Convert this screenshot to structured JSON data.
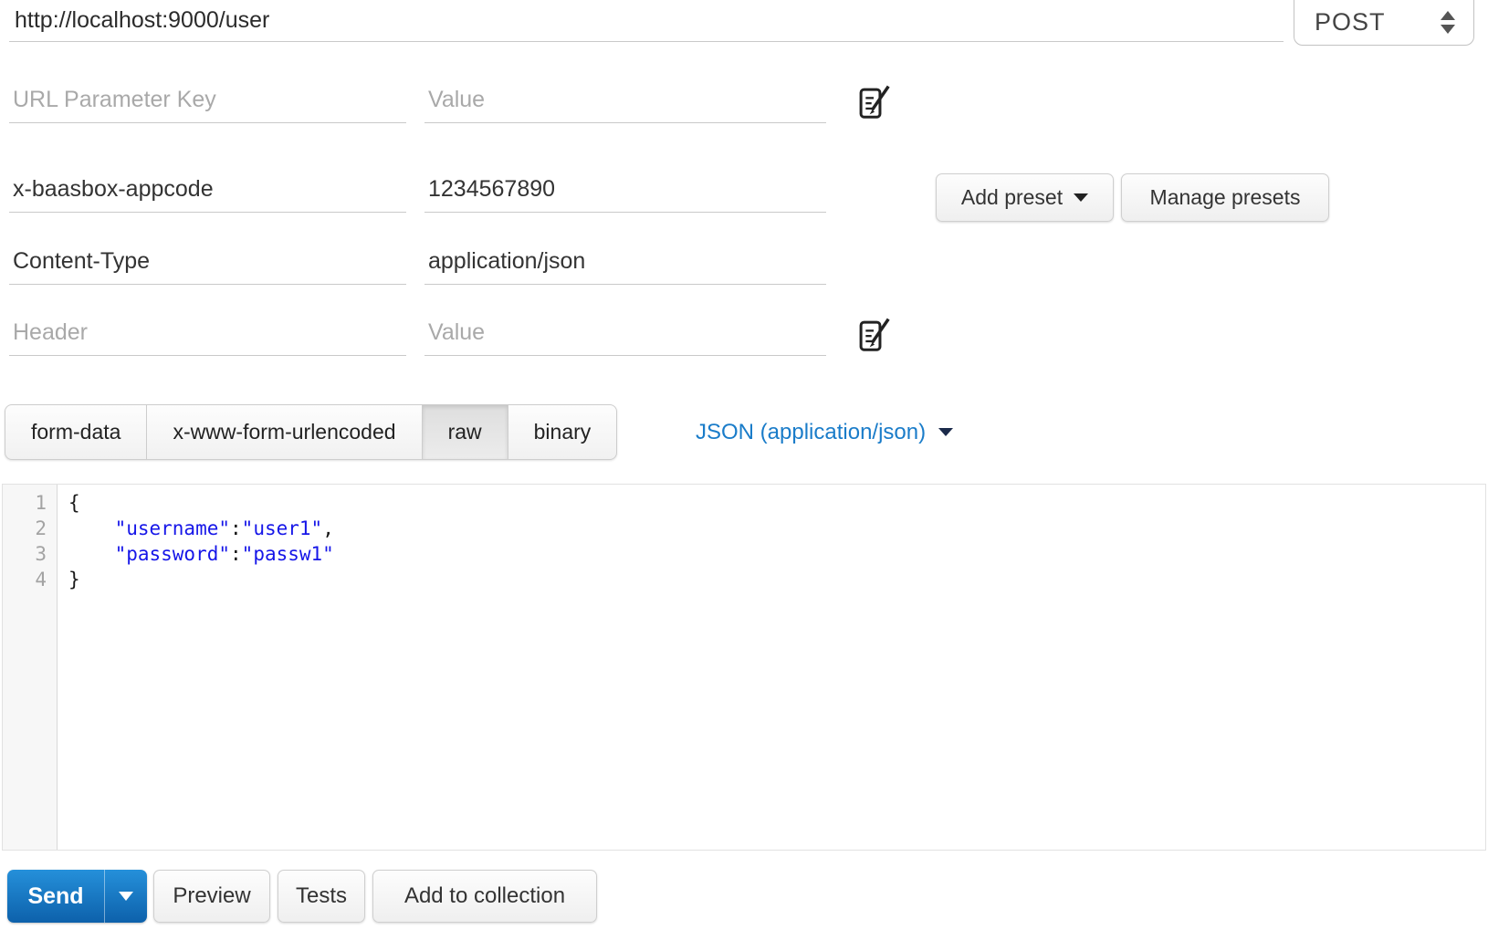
{
  "request": {
    "url": "http://localhost:9000/user",
    "method": "POST"
  },
  "url_params": {
    "key_placeholder": "URL Parameter Key",
    "value_placeholder": "Value"
  },
  "headers": {
    "rows": [
      {
        "key": "x-baasbox-appcode",
        "value": "1234567890"
      },
      {
        "key": "Content-Type",
        "value": "application/json"
      }
    ],
    "key_placeholder": "Header",
    "value_placeholder": "Value"
  },
  "presets": {
    "add_label": "Add preset",
    "manage_label": "Manage presets"
  },
  "body_tabs": [
    {
      "label": "form-data",
      "active": false
    },
    {
      "label": "x-www-form-urlencoded",
      "active": false
    },
    {
      "label": "raw",
      "active": true
    },
    {
      "label": "binary",
      "active": false
    }
  ],
  "content_type_selector": {
    "label": "JSON (application/json)"
  },
  "editor": {
    "lines": [
      {
        "num": "1",
        "tokens": [
          {
            "t": "{",
            "c": "plain"
          }
        ]
      },
      {
        "num": "2",
        "tokens": [
          {
            "t": "    ",
            "c": "plain"
          },
          {
            "t": "\"username\"",
            "c": "string"
          },
          {
            "t": ":",
            "c": "plain"
          },
          {
            "t": "\"user1\"",
            "c": "string"
          },
          {
            "t": ",",
            "c": "plain"
          }
        ]
      },
      {
        "num": "3",
        "tokens": [
          {
            "t": "    ",
            "c": "plain"
          },
          {
            "t": "\"password\"",
            "c": "string"
          },
          {
            "t": ":",
            "c": "plain"
          },
          {
            "t": "\"passw1\"",
            "c": "string"
          }
        ]
      },
      {
        "num": "4",
        "tokens": [
          {
            "t": "}",
            "c": "plain"
          }
        ]
      }
    ]
  },
  "actions": {
    "send": "Send",
    "preview": "Preview",
    "tests": "Tests",
    "add_to_collection": "Add to collection"
  },
  "colors": {
    "accent_blue": "#1a7cc9",
    "string_blue": "#1616e8",
    "send_gradient_top": "#2590da",
    "send_gradient_bottom": "#0d61ab"
  }
}
